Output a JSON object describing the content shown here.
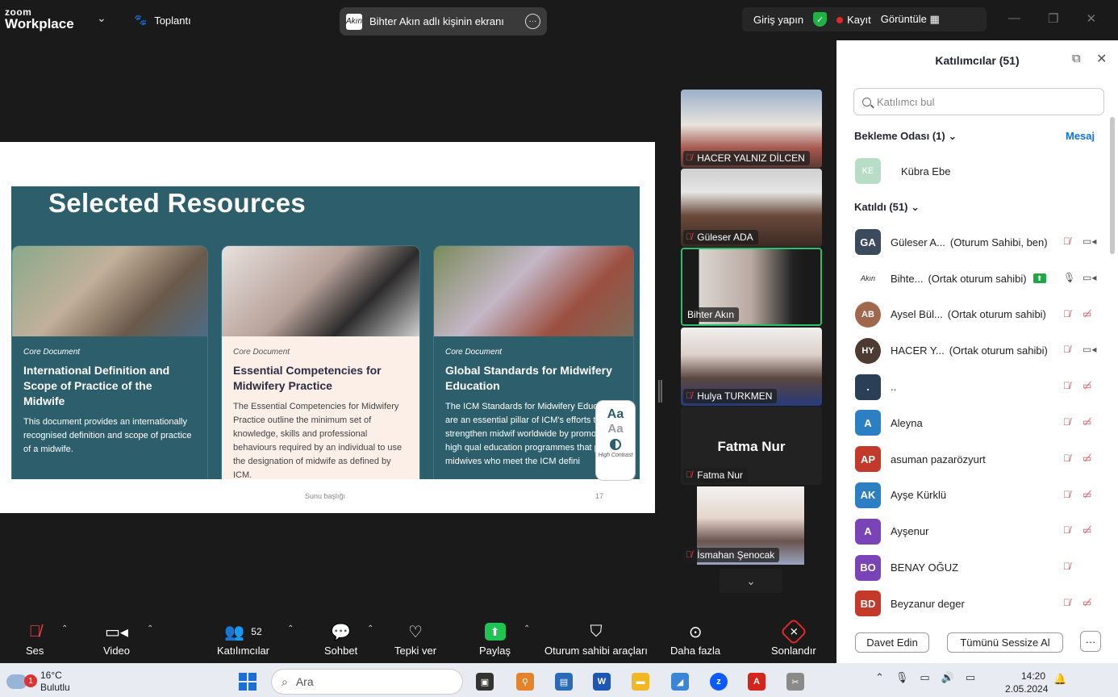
{
  "topbar": {
    "logo_line1": "zoom",
    "logo_line2": "Workplace",
    "meeting_label": "Toplantı",
    "share_status": "Bihter Akın adlı kişinin ekranı",
    "share_avatar": "Akın",
    "signin": "Giriş yapın",
    "record": "Kayıt",
    "view": "Görüntüle"
  },
  "slide": {
    "title": "Selected Resources",
    "footer": "Sunu başlığı",
    "page_number": "17",
    "cards": [
      {
        "tag": "Core Document",
        "title": "International Definition and Scope of Practice of the Midwife",
        "desc": "This document provides an internationally recognised definition and scope of practice of a midwife."
      },
      {
        "tag": "Core Document",
        "title": "Essential Competencies for Midwifery Practice",
        "desc": "The Essential Competencies for Midwifery Practice outline the minimum set of knowledge, skills and professional behaviours required by an individual to use the designation of midwife as defined by ICM."
      },
      {
        "tag": "Core Document",
        "title": "Global Standards for Midwifery Education",
        "desc": "The ICM Standards for Midwifery Education are an essential pillar of ICM's efforts to strengthen midwif worldwide by promoting high qual education programmes that prepa midwives who meet the ICM defini"
      }
    ],
    "contrast_badge": {
      "a1": "Aa",
      "a2": "Aa",
      "label": "High Contrast"
    }
  },
  "tiles": [
    {
      "name": "HACER YALNIZ DİLCEN"
    },
    {
      "name": "Güleser ADA"
    },
    {
      "name": "Bihter Akın"
    },
    {
      "name": "Hulya TURKMEN"
    },
    {
      "name": "Fatma Nur",
      "big": "Fatma Nur"
    },
    {
      "name": "İsmahan Şenocak"
    }
  ],
  "panel": {
    "title": "Katılımcılar (51)",
    "search_placeholder": "Katılımcı bul",
    "waiting_header": "Bekleme Odası (1)",
    "message_link": "Mesaj",
    "waiting": [
      {
        "initials": "KE",
        "name": "Kübra Ebe",
        "color": "#b9dcc7"
      }
    ],
    "joined_header": "Katıldı (51)",
    "participants": [
      {
        "initials": "GA",
        "name": "Güleser A...",
        "role": "(Oturum Sahibi, ben)",
        "color": "#3c4a5e"
      },
      {
        "initials": "Akın",
        "name": "Bihte...",
        "role": "(Ortak oturum sahibi)",
        "color": "#ffffff"
      },
      {
        "initials": "AB",
        "name": "Aysel Bül...",
        "role": "(Ortak oturum sahibi)",
        "color": "#a0674d"
      },
      {
        "initials": "HY",
        "name": "HACER Y...",
        "role": "(Ortak oturum sahibi)",
        "color": "#4d3a33"
      },
      {
        "initials": ".",
        "name": "..",
        "role": "",
        "color": "#2b3f57"
      },
      {
        "initials": "A",
        "name": "Aleyna",
        "role": "",
        "color": "#2d7fc4"
      },
      {
        "initials": "AP",
        "name": "asuman pazarözyurt",
        "role": "",
        "color": "#c33a2a"
      },
      {
        "initials": "AK",
        "name": "Ayşe Kürklü",
        "role": "",
        "color": "#2d7fc4"
      },
      {
        "initials": "A",
        "name": "Ayşenur",
        "role": "",
        "color": "#7a44b8"
      },
      {
        "initials": "BO",
        "name": "BENAY OĞUZ",
        "role": "",
        "color": "#7a44b8"
      },
      {
        "initials": "BD",
        "name": "Beyzanur deger",
        "role": "",
        "color": "#c33a2a"
      }
    ],
    "invite": "Davet Edin",
    "mute_all": "Tümünü Sessize Al",
    "more": "···"
  },
  "toolbar": {
    "audio": "Ses",
    "video": "Video",
    "participants": "Katılımcılar",
    "participants_count": "52",
    "chat": "Sohbet",
    "react": "Tepki ver",
    "share": "Paylaş",
    "host_tools": "Oturum sahibi araçları",
    "more": "Daha fazla",
    "end": "Sonlandır"
  },
  "taskbar": {
    "weather_temp": "16°C",
    "weather_desc": "Bulutlu",
    "weather_badge": "1",
    "search": "Ara",
    "time": "14:20",
    "date": "2.05.2024"
  }
}
